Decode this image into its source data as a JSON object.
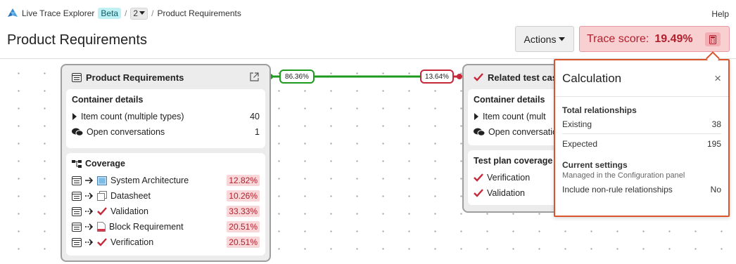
{
  "breadcrumb": {
    "app_name": "Live Trace Explorer",
    "beta_label": "Beta",
    "version_label": "2",
    "page_name": "Product Requirements"
  },
  "header": {
    "help_label": "Help",
    "title": "Product Requirements",
    "actions_label": "Actions",
    "trace_score_label": "Trace score:",
    "trace_score_value": "19.49%"
  },
  "colors": {
    "accent_red": "#b2202e",
    "link_green": "#1e9a1e",
    "popover_border": "#d9542b"
  },
  "left_card": {
    "title": "Product Requirements",
    "details": {
      "heading": "Container details",
      "rows": [
        {
          "label": "Item count (multiple types)",
          "value": "40"
        },
        {
          "label": "Open conversations",
          "value": "1"
        }
      ]
    },
    "coverage": {
      "heading": "Coverage",
      "rows": [
        {
          "label": "System Architecture",
          "value": "12.82%",
          "icon": "architecture-icon"
        },
        {
          "label": "Datasheet",
          "value": "10.26%",
          "icon": "datasheet-icon"
        },
        {
          "label": "Validation",
          "value": "33.33%",
          "icon": "checkmark-icon"
        },
        {
          "label": "Block Requirement",
          "value": "20.51%",
          "icon": "document-icon"
        },
        {
          "label": "Verification",
          "value": "20.51%",
          "icon": "checkmark-icon"
        }
      ]
    }
  },
  "connection": {
    "left_label": "86.36%",
    "right_label": "13.64%"
  },
  "right_card": {
    "title": "Related test cas",
    "details": {
      "heading": "Container details",
      "rows": [
        {
          "label": "Item count (mult"
        },
        {
          "label": "Open conversatio"
        }
      ]
    },
    "test_plan": {
      "heading": "Test plan coverage",
      "rows": [
        {
          "label": "Verification"
        },
        {
          "label": "Validation"
        }
      ]
    }
  },
  "calculation": {
    "title": "Calculation",
    "close_label": "×",
    "total_heading": "Total relationships",
    "existing_label": "Existing",
    "existing_value": "38",
    "expected_label": "Expected",
    "expected_value": "195",
    "settings_heading": "Current settings",
    "settings_note": "Managed in the Configuration panel",
    "nonrule_label": "Include non-rule relationships",
    "nonrule_value": "No"
  }
}
